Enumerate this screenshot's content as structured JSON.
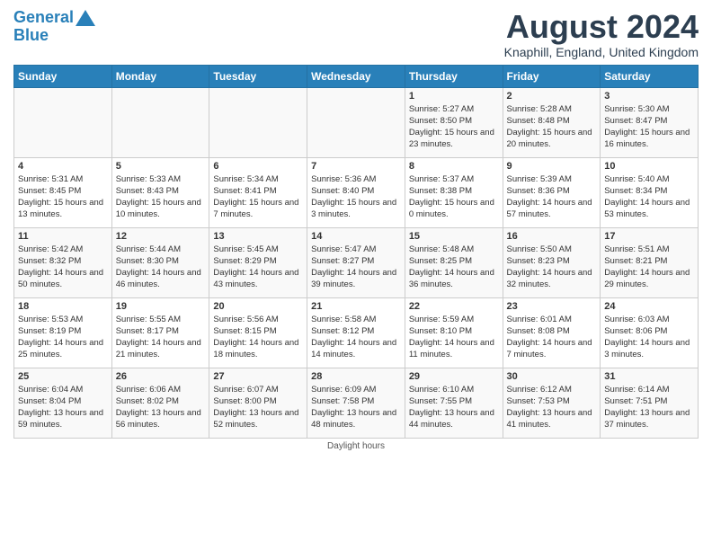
{
  "header": {
    "logo_line1": "General",
    "logo_line2": "Blue",
    "month_title": "August 2024",
    "location": "Knaphill, England, United Kingdom"
  },
  "days_of_week": [
    "Sunday",
    "Monday",
    "Tuesday",
    "Wednesday",
    "Thursday",
    "Friday",
    "Saturday"
  ],
  "footer": {
    "daylight_label": "Daylight hours"
  },
  "weeks": [
    [
      {
        "day": "",
        "sunrise": "",
        "sunset": "",
        "daylight": ""
      },
      {
        "day": "",
        "sunrise": "",
        "sunset": "",
        "daylight": ""
      },
      {
        "day": "",
        "sunrise": "",
        "sunset": "",
        "daylight": ""
      },
      {
        "day": "",
        "sunrise": "",
        "sunset": "",
        "daylight": ""
      },
      {
        "day": "1",
        "sunrise": "5:27 AM",
        "sunset": "8:50 PM",
        "daylight": "15 hours and 23 minutes."
      },
      {
        "day": "2",
        "sunrise": "5:28 AM",
        "sunset": "8:48 PM",
        "daylight": "15 hours and 20 minutes."
      },
      {
        "day": "3",
        "sunrise": "5:30 AM",
        "sunset": "8:47 PM",
        "daylight": "15 hours and 16 minutes."
      }
    ],
    [
      {
        "day": "4",
        "sunrise": "5:31 AM",
        "sunset": "8:45 PM",
        "daylight": "15 hours and 13 minutes."
      },
      {
        "day": "5",
        "sunrise": "5:33 AM",
        "sunset": "8:43 PM",
        "daylight": "15 hours and 10 minutes."
      },
      {
        "day": "6",
        "sunrise": "5:34 AM",
        "sunset": "8:41 PM",
        "daylight": "15 hours and 7 minutes."
      },
      {
        "day": "7",
        "sunrise": "5:36 AM",
        "sunset": "8:40 PM",
        "daylight": "15 hours and 3 minutes."
      },
      {
        "day": "8",
        "sunrise": "5:37 AM",
        "sunset": "8:38 PM",
        "daylight": "15 hours and 0 minutes."
      },
      {
        "day": "9",
        "sunrise": "5:39 AM",
        "sunset": "8:36 PM",
        "daylight": "14 hours and 57 minutes."
      },
      {
        "day": "10",
        "sunrise": "5:40 AM",
        "sunset": "8:34 PM",
        "daylight": "14 hours and 53 minutes."
      }
    ],
    [
      {
        "day": "11",
        "sunrise": "5:42 AM",
        "sunset": "8:32 PM",
        "daylight": "14 hours and 50 minutes."
      },
      {
        "day": "12",
        "sunrise": "5:44 AM",
        "sunset": "8:30 PM",
        "daylight": "14 hours and 46 minutes."
      },
      {
        "day": "13",
        "sunrise": "5:45 AM",
        "sunset": "8:29 PM",
        "daylight": "14 hours and 43 minutes."
      },
      {
        "day": "14",
        "sunrise": "5:47 AM",
        "sunset": "8:27 PM",
        "daylight": "14 hours and 39 minutes."
      },
      {
        "day": "15",
        "sunrise": "5:48 AM",
        "sunset": "8:25 PM",
        "daylight": "14 hours and 36 minutes."
      },
      {
        "day": "16",
        "sunrise": "5:50 AM",
        "sunset": "8:23 PM",
        "daylight": "14 hours and 32 minutes."
      },
      {
        "day": "17",
        "sunrise": "5:51 AM",
        "sunset": "8:21 PM",
        "daylight": "14 hours and 29 minutes."
      }
    ],
    [
      {
        "day": "18",
        "sunrise": "5:53 AM",
        "sunset": "8:19 PM",
        "daylight": "14 hours and 25 minutes."
      },
      {
        "day": "19",
        "sunrise": "5:55 AM",
        "sunset": "8:17 PM",
        "daylight": "14 hours and 21 minutes."
      },
      {
        "day": "20",
        "sunrise": "5:56 AM",
        "sunset": "8:15 PM",
        "daylight": "14 hours and 18 minutes."
      },
      {
        "day": "21",
        "sunrise": "5:58 AM",
        "sunset": "8:12 PM",
        "daylight": "14 hours and 14 minutes."
      },
      {
        "day": "22",
        "sunrise": "5:59 AM",
        "sunset": "8:10 PM",
        "daylight": "14 hours and 11 minutes."
      },
      {
        "day": "23",
        "sunrise": "6:01 AM",
        "sunset": "8:08 PM",
        "daylight": "14 hours and 7 minutes."
      },
      {
        "day": "24",
        "sunrise": "6:03 AM",
        "sunset": "8:06 PM",
        "daylight": "14 hours and 3 minutes."
      }
    ],
    [
      {
        "day": "25",
        "sunrise": "6:04 AM",
        "sunset": "8:04 PM",
        "daylight": "13 hours and 59 minutes."
      },
      {
        "day": "26",
        "sunrise": "6:06 AM",
        "sunset": "8:02 PM",
        "daylight": "13 hours and 56 minutes."
      },
      {
        "day": "27",
        "sunrise": "6:07 AM",
        "sunset": "8:00 PM",
        "daylight": "13 hours and 52 minutes."
      },
      {
        "day": "28",
        "sunrise": "6:09 AM",
        "sunset": "7:58 PM",
        "daylight": "13 hours and 48 minutes."
      },
      {
        "day": "29",
        "sunrise": "6:10 AM",
        "sunset": "7:55 PM",
        "daylight": "13 hours and 44 minutes."
      },
      {
        "day": "30",
        "sunrise": "6:12 AM",
        "sunset": "7:53 PM",
        "daylight": "13 hours and 41 minutes."
      },
      {
        "day": "31",
        "sunrise": "6:14 AM",
        "sunset": "7:51 PM",
        "daylight": "13 hours and 37 minutes."
      }
    ]
  ]
}
